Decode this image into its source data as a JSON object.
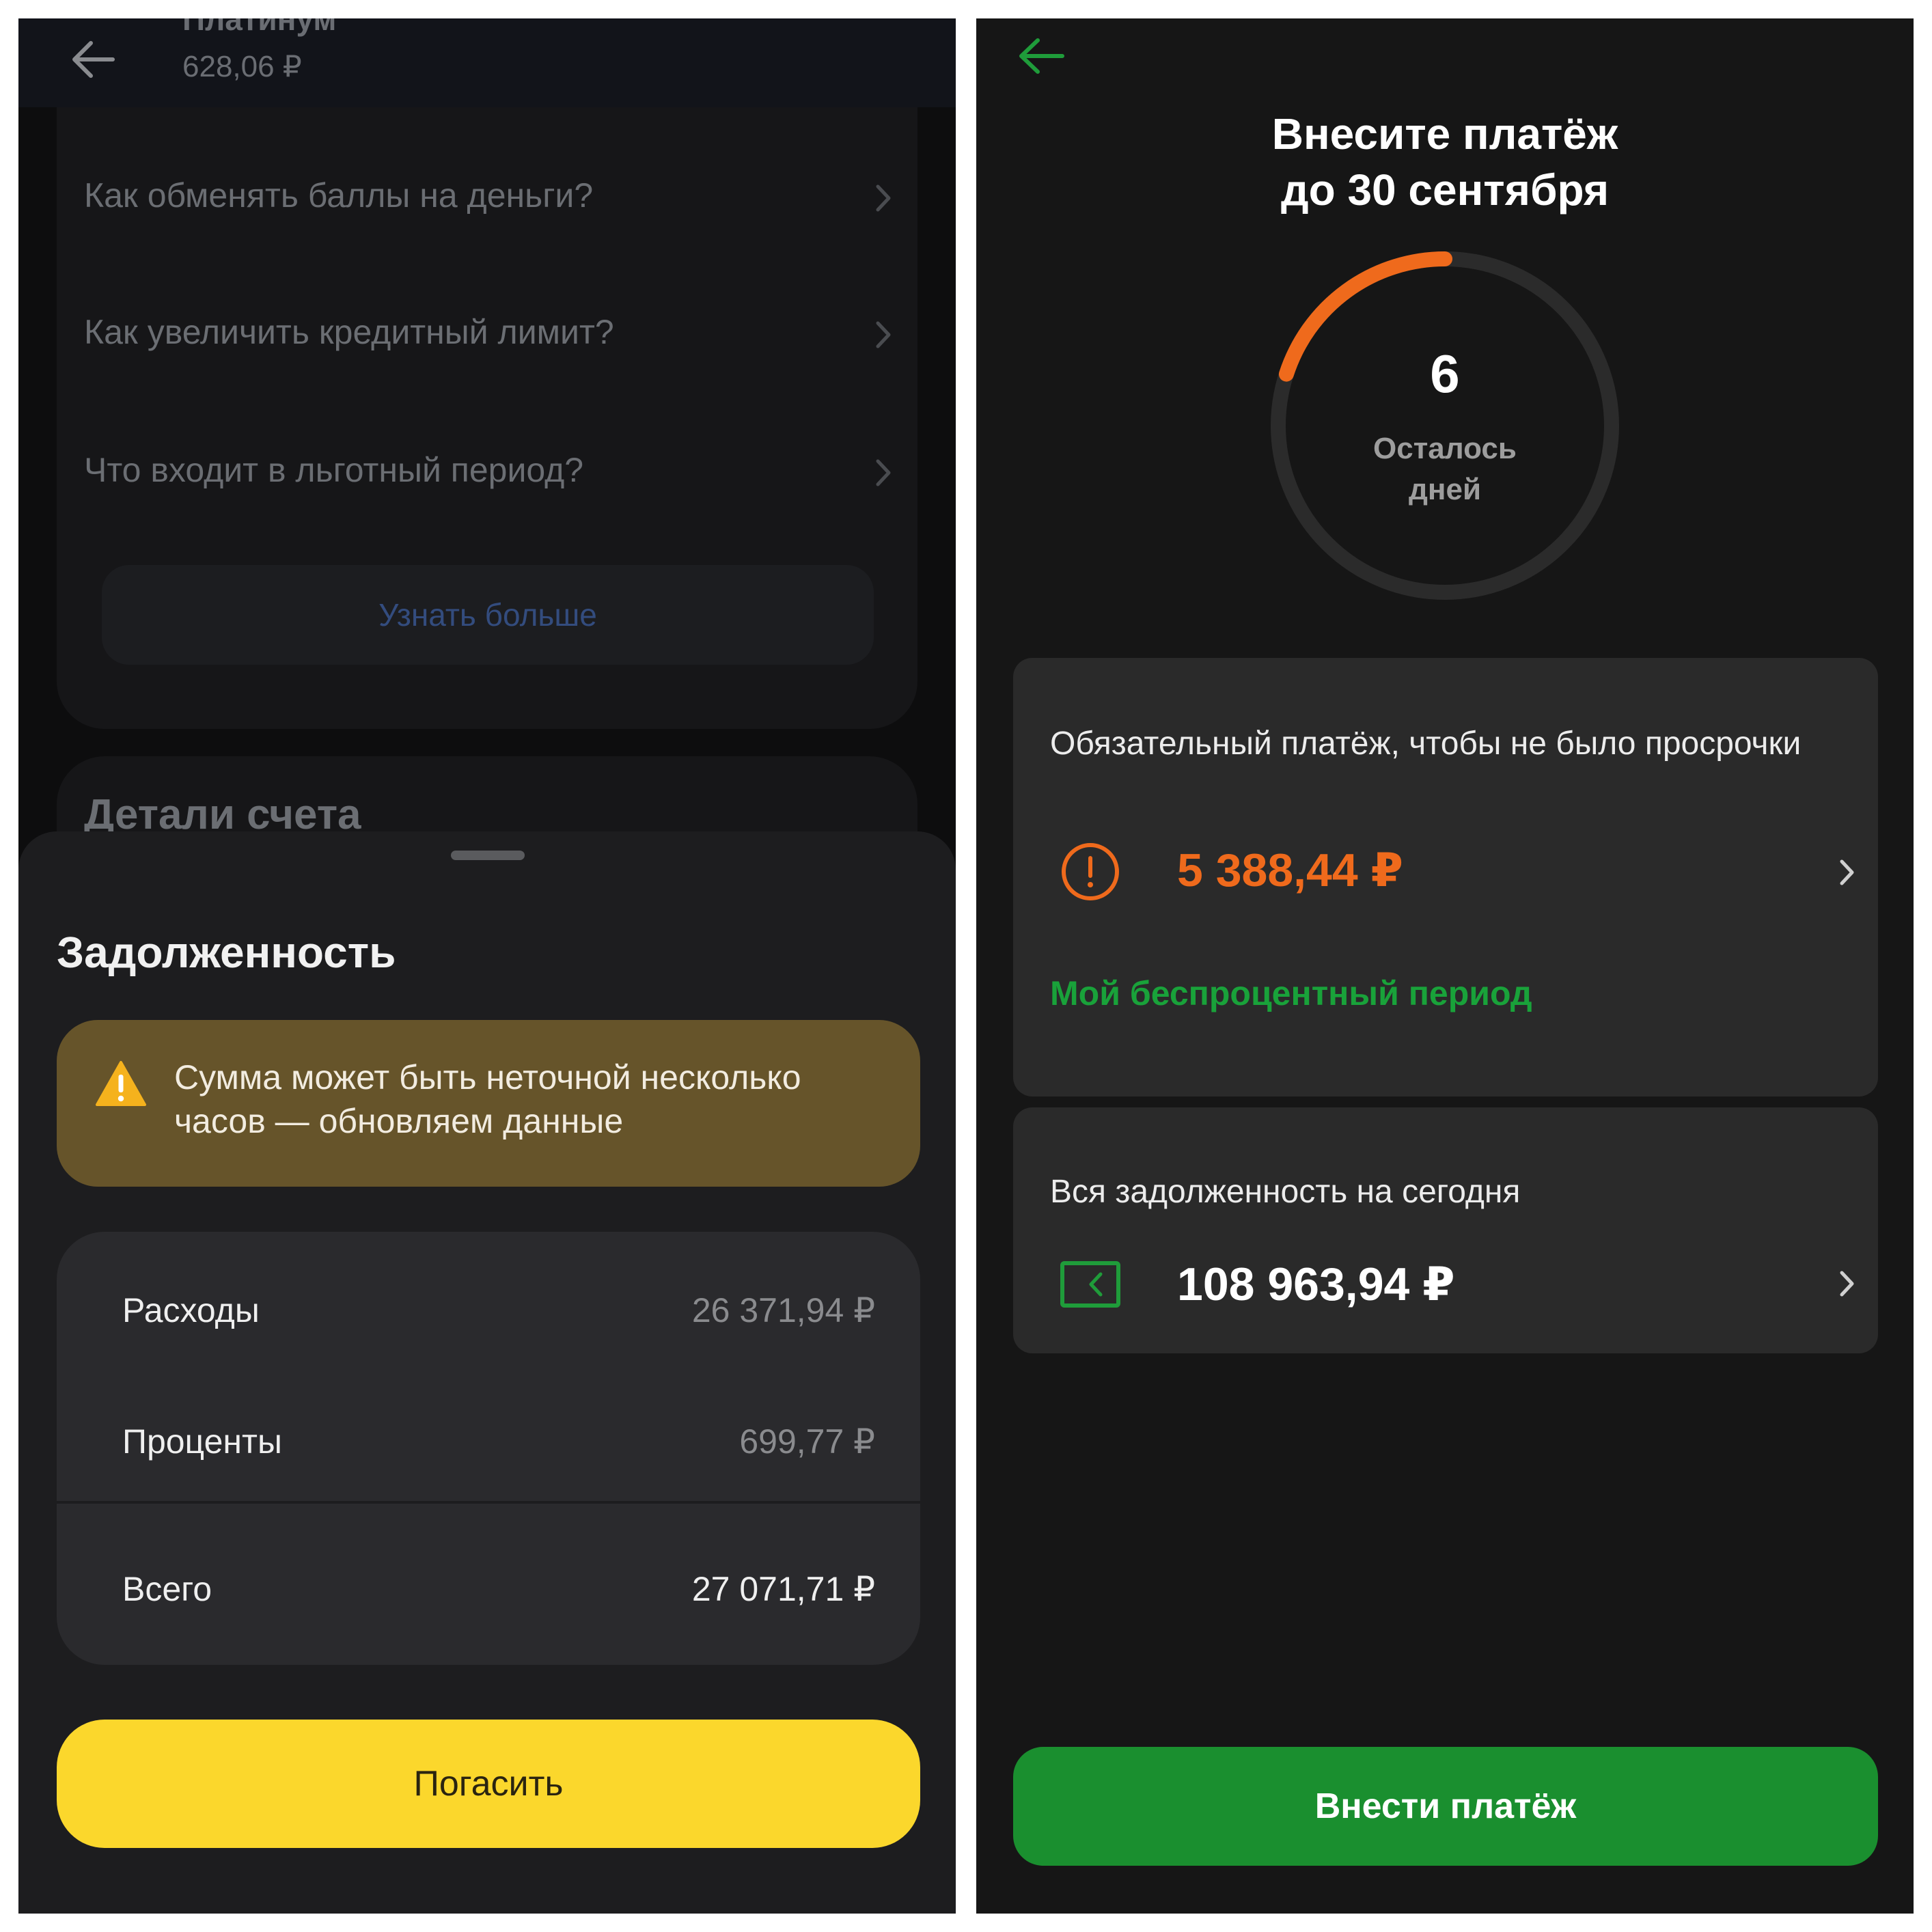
{
  "left": {
    "header": {
      "title": "Платинум",
      "subtitle": "628,06 ₽"
    },
    "faq": [
      {
        "label": "Как обменять баллы на деньги?"
      },
      {
        "label": "Как увеличить кредитный лимит?"
      },
      {
        "label": "Что входит в льготный период?"
      }
    ],
    "learn_more": "Узнать больше",
    "details_title": "Детали счета",
    "sheet": {
      "title": "Задолженность",
      "warning": "Сумма может быть неточной несколько часов — обновляем данные",
      "rows": [
        {
          "label": "Расходы",
          "value": "26 371,94 ₽"
        },
        {
          "label": "Проценты",
          "value": "699,77 ₽"
        },
        {
          "label": "Всего",
          "value": "27 071,71 ₽"
        }
      ],
      "pay_button": "Погасить"
    },
    "colors": {
      "accent": "#fbd72c",
      "warning_bg": "#66542a",
      "link": "#334c7e"
    },
    "icons": [
      "back-arrow-icon",
      "chevron-right-icon",
      "warning-triangle-icon"
    ]
  },
  "right": {
    "title_line1": "Внесите платёж",
    "title_line2": "до 30 сентября",
    "days_left": "6",
    "days_caption_line1": "Осталось",
    "days_caption_line2": "дней",
    "days_progress_fraction": 0.2,
    "required_payment": {
      "title": "Обязательный платёж, чтобы не было просрочки",
      "amount": "5 388,44 ₽",
      "link": "Мой беспроцентный период"
    },
    "total_debt": {
      "title": "Вся задолженность на сегодня",
      "amount": "108 963,94 ₽"
    },
    "deposit_button": "Внести платёж",
    "colors": {
      "accent": "#1a8f2f",
      "warning": "#ef6a1c",
      "ring_track": "#2b2b2b"
    },
    "icons": [
      "back-arrow-icon",
      "exclamation-circle-icon",
      "wallet-icon",
      "chevron-right-icon"
    ]
  }
}
